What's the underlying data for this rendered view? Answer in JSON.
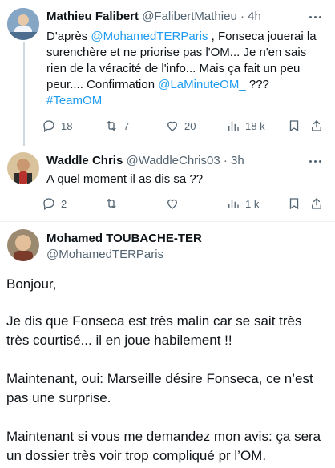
{
  "tweets": [
    {
      "name": "Mathieu Falibert",
      "handle": "@FalibertMathieu",
      "separator": "·",
      "time": "4h",
      "text_1": "D'après ",
      "mention_1": "@MohamedTERParis",
      "text_2": " , Fonseca jouerai la surenchère et ne priorise pas l'OM... Je n'en sais rien de la véracité de l'info... Mais ça fait un peu peur.... Confirmation ",
      "mention_2": "@LaMinuteOM_",
      "text_3": " ???",
      "hashtag": "#TeamOM",
      "stats": {
        "replies": "18",
        "reposts": "7",
        "likes": "20",
        "views": "18 k"
      },
      "avatar_colors": {
        "bg": "#6f8fb0",
        "accent": "#d0e0ee"
      }
    },
    {
      "name": "Waddle Chris",
      "handle": "@WaddleChris03",
      "separator": "·",
      "time": "3h",
      "text": "A quel moment il as dis sa ??",
      "stats": {
        "replies": "2",
        "reposts": "",
        "likes": "",
        "views": "1 k"
      },
      "avatar_colors": {
        "bg": "#c9b48a",
        "accent": "#8d6a3d"
      }
    }
  ],
  "main_tweet": {
    "name": "Mohamed TOUBACHE-TER",
    "handle": "@MohamedTERParis",
    "paragraphs": [
      "Bonjour,",
      "Je dis que Fonseca est très malin car se sait très très courtisé... il en joue habilement !!",
      "Maintenant, oui: Marseille désire Fonseca, ce n’est pas une surprise.",
      "Maintenant si vous me demandez mon avis: ça sera un dossier très voir trop compliqué pr l’OM."
    ],
    "avatar_colors": {
      "bg": "#a38f72",
      "accent": "#e2c9a6"
    }
  },
  "colors": {
    "link": "#1d9bf0",
    "muted": "#536471",
    "text": "#0f1419",
    "line": "#cfd9de"
  },
  "icons": [
    "reply-icon",
    "repost-icon",
    "like-icon",
    "views-icon",
    "bookmark-icon",
    "share-icon",
    "more-icon"
  ]
}
